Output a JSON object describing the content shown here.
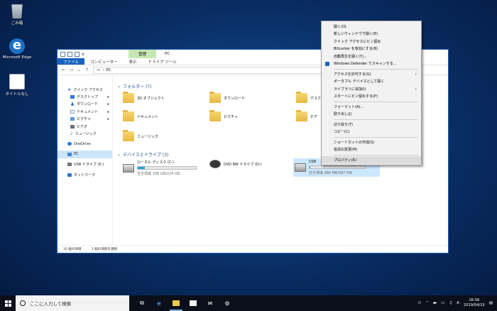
{
  "desktop": {
    "icons": [
      {
        "label": "ごみ箱"
      },
      {
        "label": "Microsoft Edge"
      },
      {
        "label": "タイトルなし"
      }
    ]
  },
  "window": {
    "title": "PC",
    "quick_access_label": "v",
    "manage_tab": "管理",
    "ribbon_tabs": [
      "ファイル",
      "コンピューター",
      "表示",
      "ドライブ ツール"
    ],
    "address_path": "PC",
    "nav_pane": [
      {
        "label": "クイック アクセス"
      },
      {
        "label": "デスクトップ"
      },
      {
        "label": "ダウンロード"
      },
      {
        "label": "ドキュメント"
      },
      {
        "label": "ピクチャ"
      },
      {
        "label": "ビデオ"
      },
      {
        "label": "ミュージック"
      },
      {
        "label": "OneDrive"
      },
      {
        "label": "PC"
      },
      {
        "label": "USB ドライブ (E:)"
      },
      {
        "label": "ネットワーク"
      }
    ],
    "folders_header": "フォルダー (7)",
    "folders": [
      "3D オブジェクト",
      "ダウンロード",
      "デスク",
      "ドキュメント",
      "ピクチャ",
      "ビデ",
      "ミュージック"
    ],
    "drives_header": "デバイスとドライブ (3)",
    "drives": [
      {
        "name": "ローカル ディスク (C:)",
        "info": "空き領域 196 GB/224 GB",
        "usage": 0.125
      },
      {
        "name": "DVD RW ドライブ (D:)",
        "info": ""
      },
      {
        "name": "USB",
        "info": "空き領域 986 MB/987 MB"
      }
    ],
    "status": [
      "10 個の項目",
      "1 個の項目を選択"
    ]
  },
  "context_menu": {
    "items": [
      {
        "label": "開く(O)"
      },
      {
        "label": "新しいウィンドウで開く(E)"
      },
      {
        "label": "クイック アクセスにピン留め"
      },
      {
        "label": "BitLocker を有効にする(B)"
      },
      {
        "label": "自動再生を開く(Y)..."
      },
      {
        "label": "Windows Defender でスキャンする..."
      },
      {
        "label": "アクセスを許可する(G)"
      },
      {
        "label": "ポータブル デバイスとして開く"
      },
      {
        "label": "ライブラリに追加(I)"
      },
      {
        "label": "スタートにピン留めする(P)"
      },
      {
        "label": "フォーマット(A)..."
      },
      {
        "label": "取り出し(J)"
      },
      {
        "label": "切り取り(T)"
      },
      {
        "label": "コピー(C)"
      },
      {
        "label": "ショートカットの作成(S)"
      },
      {
        "label": "名前の変更(M)"
      },
      {
        "label": "プロパティ(R)"
      }
    ]
  },
  "taskbar": {
    "search_placeholder": "ここに入力して検索",
    "ime": "A",
    "time": "16:56",
    "date": "2019/04/15"
  }
}
